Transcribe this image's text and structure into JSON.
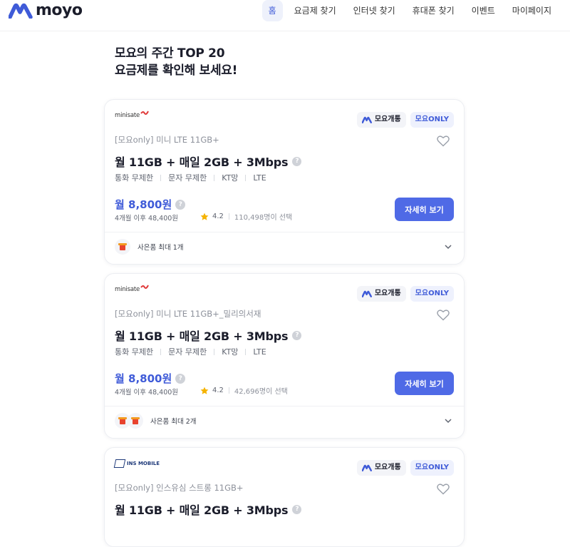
{
  "brand": {
    "logo_text": "moyo",
    "accent": "#3f5bd8",
    "button_color": "#4f6ae6"
  },
  "nav": {
    "items": [
      {
        "label": "홈",
        "active": true
      },
      {
        "label": "요금제 찾기"
      },
      {
        "label": "인터넷 찾기"
      },
      {
        "label": "휴대폰 찾기"
      },
      {
        "label": "이벤트"
      },
      {
        "label": "마이페이지"
      }
    ]
  },
  "hero": {
    "line1": "모요의 주간 TOP 20",
    "line2": "요금제를 확인해 보세요!"
  },
  "cards": [
    {
      "brand": "minisate",
      "badge_moyo": "모요개통",
      "badge_only": "모요ONLY",
      "subtitle": "[모요only] 미니 LTE 11GB+",
      "title": "월 11GB + 매일 2GB + 3Mbps",
      "tags": [
        "통화 무제한",
        "문자 무제한",
        "KT망",
        "LTE"
      ],
      "price": "월 8,800원",
      "after": "4개월 이후 48,400원",
      "rating": "4.2",
      "selected_count": "110,498명이 선택",
      "button": "자세히 보기",
      "gift_count": 1,
      "gift_text": "사은품 최대 1개"
    },
    {
      "brand": "minisate",
      "badge_moyo": "모요개통",
      "badge_only": "모요ONLY",
      "subtitle": "[모요only] 미니 LTE 11GB+_밀리의서재",
      "title": "월 11GB + 매일 2GB + 3Mbps",
      "tags": [
        "통화 무제한",
        "문자 무제한",
        "KT망",
        "LTE"
      ],
      "price": "월 8,800원",
      "after": "4개월 이후 48,400원",
      "rating": "4.2",
      "selected_count": "42,696명이 선택",
      "button": "자세히 보기",
      "gift_count": 2,
      "gift_text": "사은품 최대 2개"
    },
    {
      "brand": "INS MOBILE",
      "badge_moyo": "모요개통",
      "badge_only": "모요ONLY",
      "subtitle": "[모요only] 인스유심 스트롱 11GB+",
      "title": "월 11GB + 매일 2GB + 3Mbps"
    }
  ]
}
